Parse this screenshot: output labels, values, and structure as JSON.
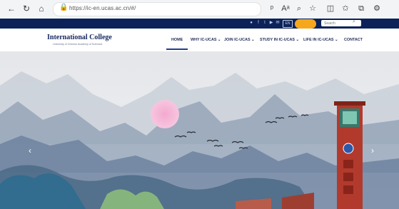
{
  "browser": {
    "back_icon": "back-arrow-icon",
    "forward_icon": "forward-arrow-icon",
    "refresh_icon": "refresh-icon",
    "home_icon": "home-icon",
    "url": "https://ic-en.ucas.ac.cn/#/",
    "toolbar_icons": [
      "read-aloud-icon",
      "text-size-icon",
      "zoom-icon",
      "favorite-icon",
      "split-screen-icon",
      "favorites-list-icon",
      "collections-icon",
      "extensions-icon"
    ]
  },
  "topbar": {
    "social_icons": [
      "weibo-icon",
      "facebook-icon",
      "twitter-icon",
      "youtube-icon",
      "email-icon"
    ],
    "lang_label": "EN",
    "search_placeholder": "Search",
    "colors": {
      "background": "#0c2259",
      "highlight": "#f6a81c"
    }
  },
  "header": {
    "title": "International College",
    "subtitle": "University of Chinese Academy of Sciences"
  },
  "nav": {
    "items": [
      "HOME",
      "WHY IC-UCAS ⌄",
      "JOIN IC-UCAS ⌄",
      "STUDY IN IC-UCAS ⌄",
      "LIFE IN IC-UCAS ⌄",
      "CONTACT"
    ],
    "active_index": 0
  },
  "hero": {
    "prev_label": "‹",
    "next_label": "›",
    "description_icon": "landscape-illustration"
  }
}
